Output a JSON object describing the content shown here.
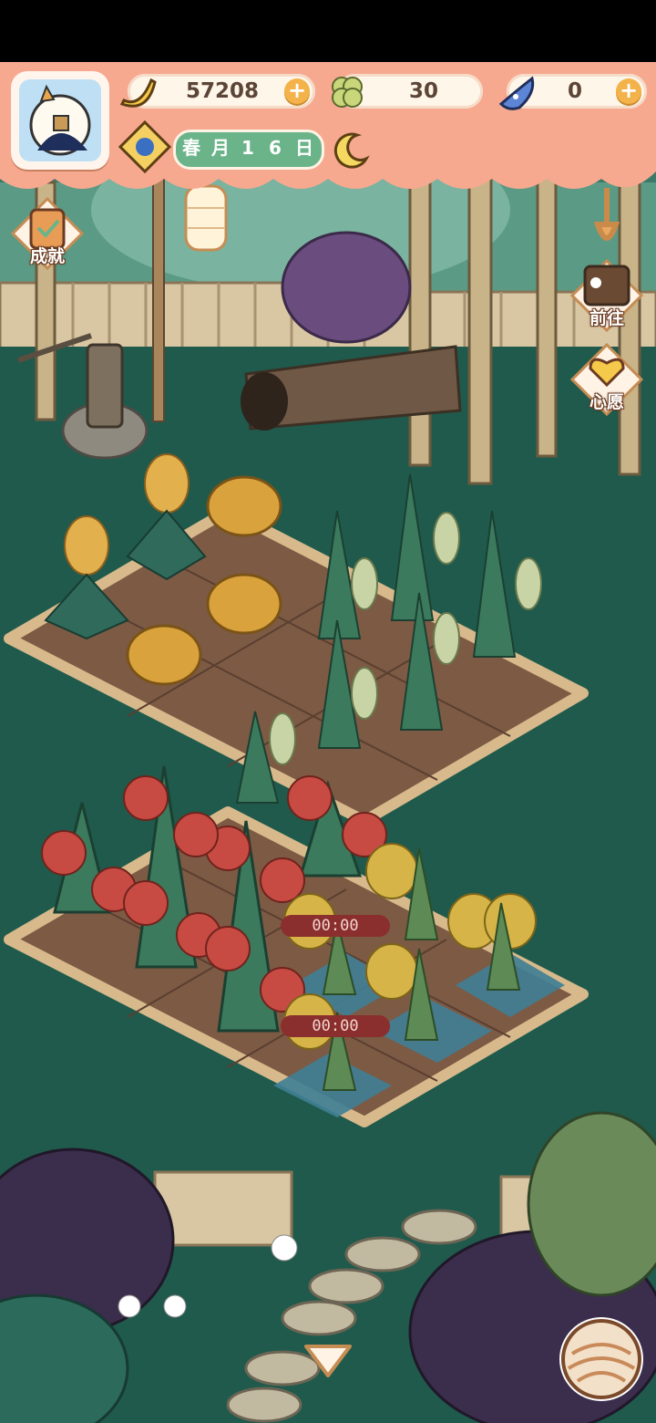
{
  "hud": {
    "bananas": "57208",
    "clovers": "30",
    "gems": "0",
    "date": [
      "春",
      "月",
      "1",
      "6",
      "日"
    ]
  },
  "side_buttons": {
    "achievements": "成就",
    "goto": "前往",
    "wish": "心愿"
  },
  "plots": {
    "timers": [
      "00:00",
      "00:00"
    ]
  },
  "colors": {
    "hud_salmon": "#f6a98f",
    "ground": "#1f5a4c",
    "date_green": "#6bb489",
    "timer_red": "#8b2e2e"
  },
  "icons": [
    "banana-icon",
    "clover-icon",
    "blue-gem-icon",
    "plus-icon",
    "moon-icon",
    "lantern-icon",
    "yarn-ball-icon",
    "down-arrow-icon"
  ]
}
